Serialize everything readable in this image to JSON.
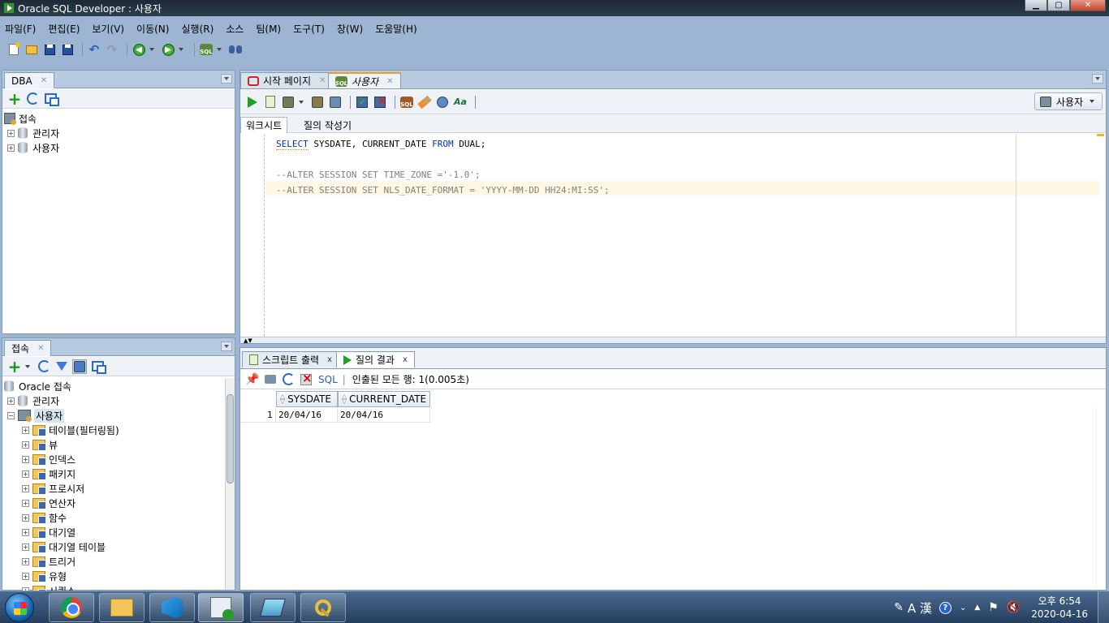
{
  "window": {
    "title": "Oracle SQL Developer : 사용자"
  },
  "menu": [
    "파일(F)",
    "편집(E)",
    "보기(V)",
    "이동(N)",
    "실행(R)",
    "소스",
    "팀(M)",
    "도구(T)",
    "창(W)",
    "도움말(H)"
  ],
  "dba_panel": {
    "tab_label": "DBA",
    "tree": [
      {
        "label": "접속",
        "level": 0
      },
      {
        "label": "관리자",
        "level": 1
      },
      {
        "label": "사용자",
        "level": 1
      }
    ]
  },
  "connections_panel": {
    "tab_label": "접속",
    "tree": [
      {
        "label": "Oracle 접속",
        "level": 0,
        "icon": "database-icon"
      },
      {
        "label": "관리자",
        "level": 1,
        "icon": "database-icon",
        "expander": "+"
      },
      {
        "label": "사용자",
        "level": 1,
        "icon": "connection-icon",
        "expander": "−"
      },
      {
        "label": "테이블(필터링됨)",
        "level": 2,
        "icon": "folder-icon",
        "expander": "+"
      },
      {
        "label": "뷰",
        "level": 2,
        "icon": "folder-icon",
        "expander": "+"
      },
      {
        "label": "인덱스",
        "level": 2,
        "icon": "folder-icon",
        "expander": "+"
      },
      {
        "label": "패키지",
        "level": 2,
        "icon": "folder-icon",
        "expander": "+"
      },
      {
        "label": "프로시저",
        "level": 2,
        "icon": "folder-icon",
        "expander": "+"
      },
      {
        "label": "연산자",
        "level": 2,
        "icon": "folder-icon",
        "expander": "+"
      },
      {
        "label": "함수",
        "level": 2,
        "icon": "folder-icon",
        "expander": "+"
      },
      {
        "label": "대기열",
        "level": 2,
        "icon": "folder-icon",
        "expander": "+"
      },
      {
        "label": "대기열 테이블",
        "level": 2,
        "icon": "folder-icon",
        "expander": "+"
      },
      {
        "label": "트리거",
        "level": 2,
        "icon": "folder-icon",
        "expander": "+"
      },
      {
        "label": "유형",
        "level": 2,
        "icon": "folder-icon",
        "expander": "+"
      },
      {
        "label": "시퀀스",
        "level": 2,
        "icon": "folder-icon",
        "expander": "+"
      }
    ]
  },
  "editor": {
    "tabs": [
      {
        "label": "시작 페이지",
        "active": false
      },
      {
        "label": "사용자",
        "active": true
      }
    ],
    "connection_selector": "사용자",
    "sub_tabs": [
      "워크시트",
      "질의 작성기"
    ],
    "code_lines": [
      {
        "text": "SELECT SYSDATE, CURRENT_DATE FROM DUAL;",
        "comment": false
      },
      {
        "text": "",
        "comment": false
      },
      {
        "text": "--ALTER SESSION SET TIME_ZONE ='-1.0';",
        "comment": true
      },
      {
        "text": "--ALTER SESSION SET NLS_DATE_FORMAT = 'YYYY-MM-DD HH24:MI:SS';",
        "comment": true
      }
    ]
  },
  "results": {
    "tabs": [
      {
        "label": "스크립트 출력",
        "active": false
      },
      {
        "label": "질의 결과",
        "active": true
      }
    ],
    "sql_label": "SQL",
    "status": "인출된 모든 행: 1(0.005초)",
    "columns": [
      "SYSDATE",
      "CURRENT_DATE"
    ],
    "rows": [
      {
        "num": "1",
        "cells": [
          "20/04/16",
          "20/04/16"
        ]
      }
    ]
  },
  "taskbar": {
    "ime_label": "A 漢",
    "clock_time": "오후 6:54",
    "clock_date": "2020-04-16"
  }
}
